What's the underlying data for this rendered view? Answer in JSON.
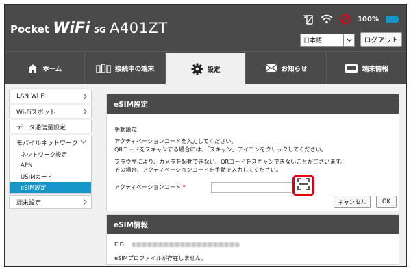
{
  "header": {
    "brand": {
      "pocket": "Pocket",
      "wifi": "WiFi",
      "fiveg": "5G",
      "model": "A401ZT"
    },
    "status": {
      "battery_text": "100%",
      "sim_indicator": "X"
    },
    "language": {
      "selected": "日本語"
    },
    "logout_label": "ログアウト"
  },
  "nav": {
    "tabs": [
      {
        "label": "ホーム",
        "icon": "home-icon"
      },
      {
        "label": "接続中の端末",
        "icon": "devices-icon"
      },
      {
        "label": "設定",
        "icon": "gear-icon"
      },
      {
        "label": "お知らせ",
        "icon": "mail-icon"
      },
      {
        "label": "端末情報",
        "icon": "device-info-icon"
      }
    ]
  },
  "sidebar": {
    "items": [
      {
        "label": "LAN Wi-Fi"
      },
      {
        "label": "Wi-Fiスポット"
      },
      {
        "label": "データ通信量設定"
      },
      {
        "label": "モバイルネットワーク"
      },
      {
        "label": "端末設定"
      }
    ],
    "mobile_sub": [
      {
        "label": "ネットワーク設定"
      },
      {
        "label": "APN"
      },
      {
        "label": "USIMカード"
      },
      {
        "label": "eSIM設定"
      }
    ]
  },
  "esim_settings": {
    "title": "eSIM設定",
    "section_label": "手動設定",
    "line1": "アクティベーションコードを入力してください。",
    "line2": "QRコードをスキャンする場合には、「スキャン」アイコンをクリックしてください。",
    "line3": "ブラウザにより、カメラを起動できない、QRコードをスキャンできないことがございます。",
    "line4": "その場合、アクティベーションコードを手動で入力してください。",
    "code_label": "アクティベーションコード",
    "required_mark": "*",
    "cancel_label": "キャンセル",
    "ok_label": "OK"
  },
  "esim_info": {
    "title": "eSIM情報",
    "eid_label": "EID:",
    "profile_message": "eSIMプロファイルが存在しません。"
  },
  "colors": {
    "header": "#4a4a4a",
    "accent": "#1597c9",
    "highlight": "#e00012"
  }
}
